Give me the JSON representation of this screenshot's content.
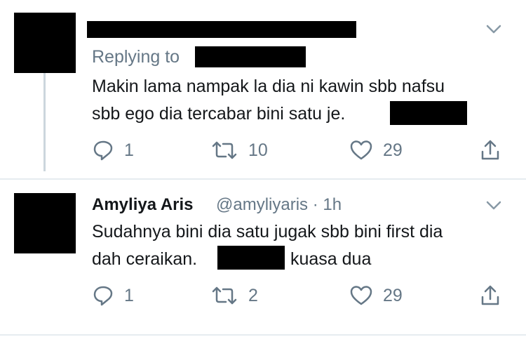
{
  "tweet1": {
    "replying_to_label": "Replying to",
    "line1": "Makin lama nampak la dia ni kawin sbb nafsu",
    "line2": "sbb ego dia tercabar bini satu je.",
    "reply_count": "1",
    "retweet_count": "10",
    "like_count": "29"
  },
  "tweet2": {
    "display_name": "Amyliya Aris",
    "handle": "@amyliyaris",
    "separator": "·",
    "time": "1h",
    "line1": "Sudahnya bini dia satu jugak sbb bini first dia",
    "line2_prefix": "dah ceraikan.",
    "line2_suffix": "kuasa dua",
    "reply_count": "1",
    "retweet_count": "2",
    "like_count": "29"
  },
  "colors": {
    "text": "#14171a",
    "secondary": "#657786",
    "divider": "#e6ecf0",
    "thread_line": "#ccd6dd"
  },
  "icons": [
    "chevron-down-icon",
    "reply-icon",
    "retweet-icon",
    "like-icon",
    "share-icon"
  ]
}
